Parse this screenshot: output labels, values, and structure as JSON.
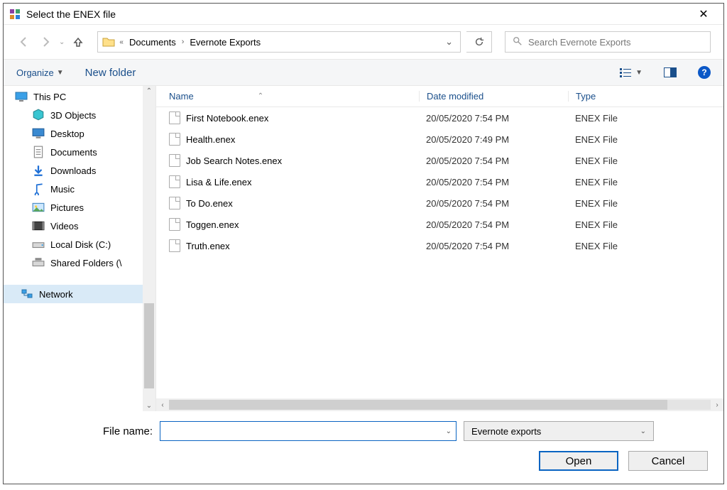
{
  "title": "Select the ENEX file",
  "breadcrumb": {
    "prev": "Documents",
    "current": "Evernote Exports"
  },
  "search_placeholder": "Search Evernote Exports",
  "toolbar": {
    "organize": "Organize",
    "newfolder": "New folder"
  },
  "columns": {
    "name": "Name",
    "date": "Date modified",
    "type": "Type"
  },
  "sidebar": {
    "root": "This PC",
    "items": [
      "3D Objects",
      "Desktop",
      "Documents",
      "Downloads",
      "Music",
      "Pictures",
      "Videos",
      "Local Disk (C:)",
      "Shared Folders (\\"
    ],
    "network": "Network"
  },
  "files": [
    {
      "name": "First Notebook.enex",
      "date": "20/05/2020 7:54 PM",
      "type": "ENEX File"
    },
    {
      "name": "Health.enex",
      "date": "20/05/2020 7:49 PM",
      "type": "ENEX File"
    },
    {
      "name": "Job Search Notes.enex",
      "date": "20/05/2020 7:54 PM",
      "type": "ENEX File"
    },
    {
      "name": "Lisa & Life.enex",
      "date": "20/05/2020 7:54 PM",
      "type": "ENEX File"
    },
    {
      "name": "To Do.enex",
      "date": "20/05/2020 7:54 PM",
      "type": "ENEX File"
    },
    {
      "name": "Toggen.enex",
      "date": "20/05/2020 7:54 PM",
      "type": "ENEX File"
    },
    {
      "name": "Truth.enex",
      "date": "20/05/2020 7:54 PM",
      "type": "ENEX File"
    }
  ],
  "filename_label": "File name:",
  "filter": "Evernote exports",
  "buttons": {
    "open": "Open",
    "cancel": "Cancel"
  }
}
